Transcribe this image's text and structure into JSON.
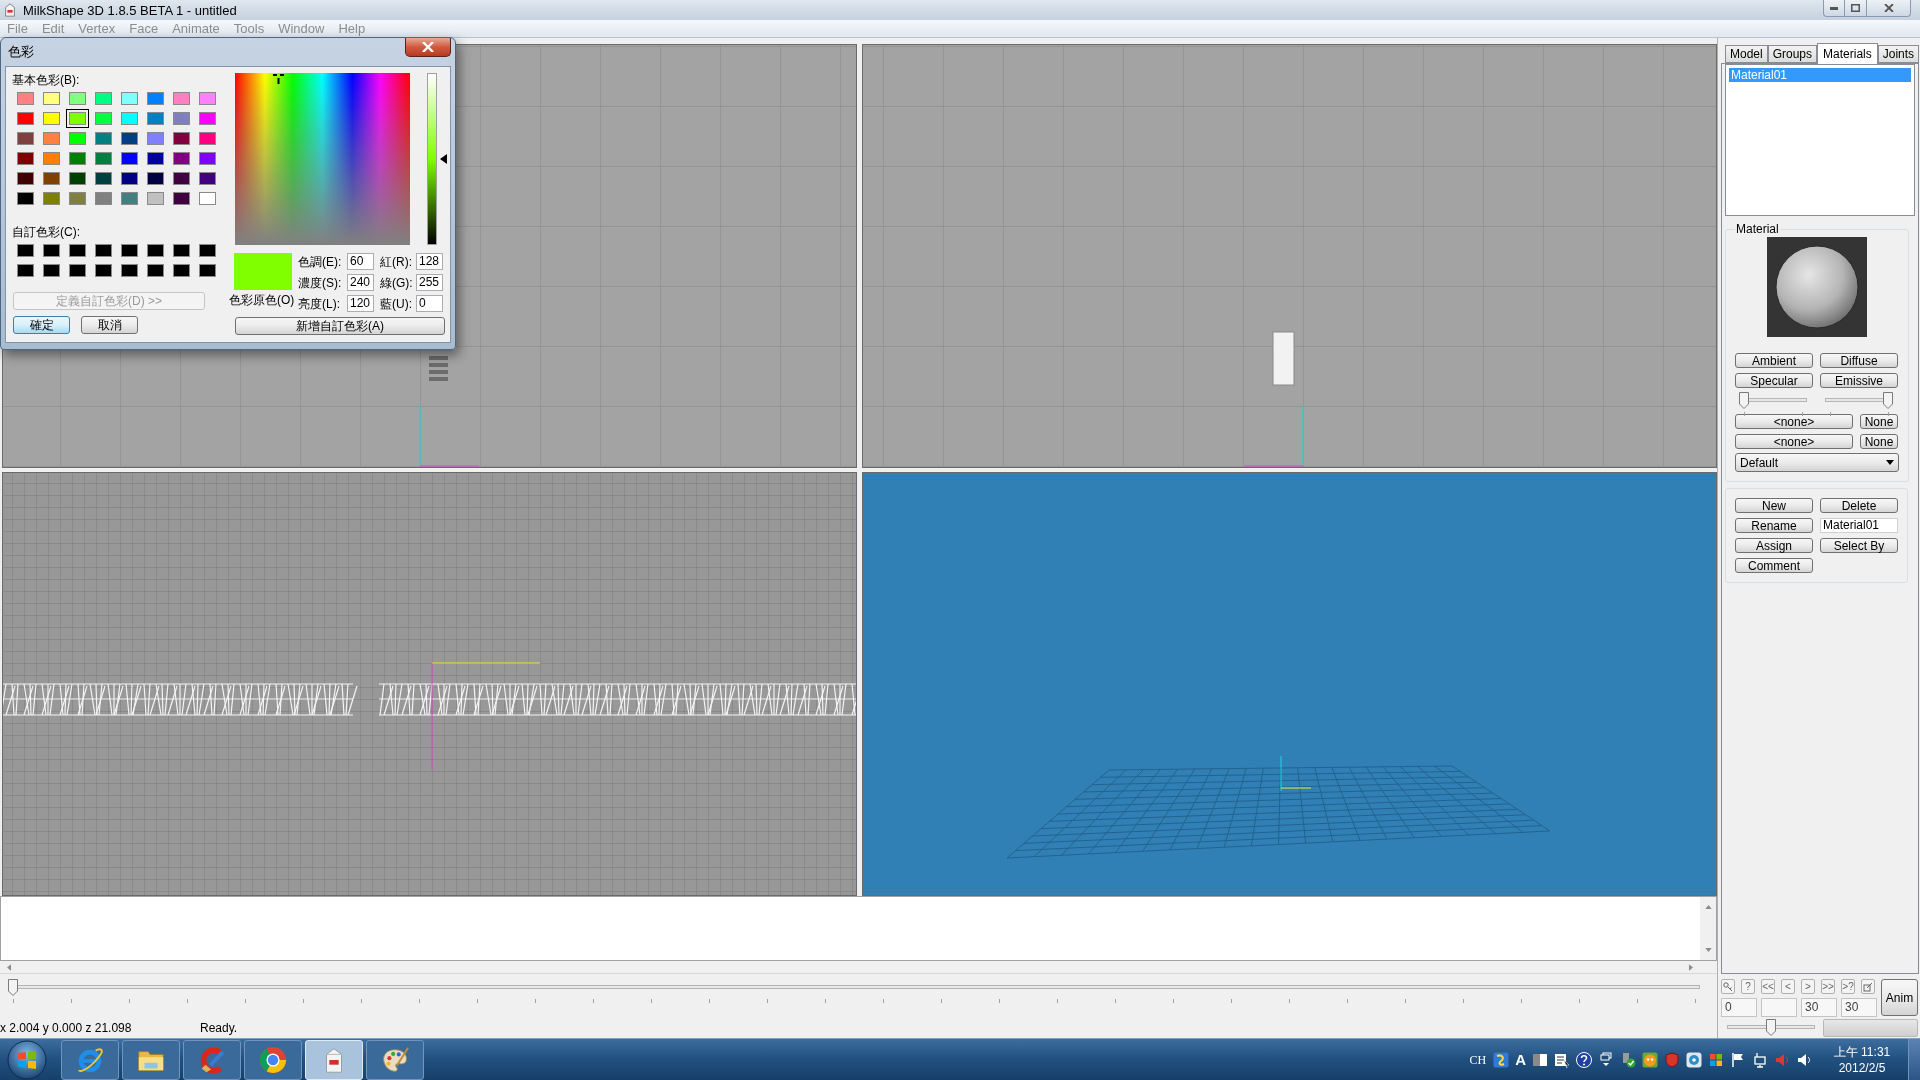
{
  "window": {
    "title": "MilkShape 3D 1.8.5 BETA 1 - untitled"
  },
  "menu": [
    {
      "label": "File",
      "disabled": true
    },
    {
      "label": "Edit",
      "disabled": true
    },
    {
      "label": "Vertex",
      "disabled": true
    },
    {
      "label": "Face",
      "disabled": true
    },
    {
      "label": "Animate",
      "disabled": true
    },
    {
      "label": "Tools",
      "disabled": true
    },
    {
      "label": "Window",
      "disabled": true
    },
    {
      "label": "Help",
      "disabled": true
    }
  ],
  "color_dialog": {
    "title": "色彩",
    "basic_label": "基本色彩(B):",
    "basic_colors": [
      {
        "color": "#ff8080",
        "selected": false
      },
      {
        "color": "#ffff80",
        "selected": false
      },
      {
        "color": "#80ff80",
        "selected": false
      },
      {
        "color": "#00ff80",
        "selected": false
      },
      {
        "color": "#80ffff",
        "selected": false
      },
      {
        "color": "#0080ff",
        "selected": false
      },
      {
        "color": "#ff80c0",
        "selected": false
      },
      {
        "color": "#ff80ff",
        "selected": false
      },
      {
        "color": "#ff0000",
        "selected": false
      },
      {
        "color": "#ffff00",
        "selected": false
      },
      {
        "color": "#80ff00",
        "selected": true
      },
      {
        "color": "#00ff40",
        "selected": false
      },
      {
        "color": "#00ffff",
        "selected": false
      },
      {
        "color": "#0080c0",
        "selected": false
      },
      {
        "color": "#8080c0",
        "selected": false
      },
      {
        "color": "#ff00ff",
        "selected": false
      },
      {
        "color": "#804040",
        "selected": false
      },
      {
        "color": "#ff8040",
        "selected": false
      },
      {
        "color": "#00ff00",
        "selected": false
      },
      {
        "color": "#008080",
        "selected": false
      },
      {
        "color": "#004080",
        "selected": false
      },
      {
        "color": "#8080ff",
        "selected": false
      },
      {
        "color": "#800040",
        "selected": false
      },
      {
        "color": "#ff0080",
        "selected": false
      },
      {
        "color": "#800000",
        "selected": false
      },
      {
        "color": "#ff8000",
        "selected": false
      },
      {
        "color": "#008000",
        "selected": false
      },
      {
        "color": "#008040",
        "selected": false
      },
      {
        "color": "#0000ff",
        "selected": false
      },
      {
        "color": "#0000a0",
        "selected": false
      },
      {
        "color": "#800080",
        "selected": false
      },
      {
        "color": "#8000ff",
        "selected": false
      },
      {
        "color": "#400000",
        "selected": false
      },
      {
        "color": "#804000",
        "selected": false
      },
      {
        "color": "#004000",
        "selected": false
      },
      {
        "color": "#004040",
        "selected": false
      },
      {
        "color": "#000080",
        "selected": false
      },
      {
        "color": "#000040",
        "selected": false
      },
      {
        "color": "#400040",
        "selected": false
      },
      {
        "color": "#400080",
        "selected": false
      },
      {
        "color": "#000000",
        "selected": false
      },
      {
        "color": "#808000",
        "selected": false
      },
      {
        "color": "#808040",
        "selected": false
      },
      {
        "color": "#808080",
        "selected": false
      },
      {
        "color": "#408080",
        "selected": false
      },
      {
        "color": "#c0c0c0",
        "selected": false
      },
      {
        "color": "#400040",
        "selected": false
      },
      {
        "color": "#ffffff",
        "selected": false
      }
    ],
    "custom_label": "自訂色彩(C):",
    "custom_colors": [
      {
        "color": "#000000",
        "selected": false
      },
      {
        "color": "#000000",
        "selected": false
      },
      {
        "color": "#000000",
        "selected": false
      },
      {
        "color": "#000000",
        "selected": false
      },
      {
        "color": "#000000",
        "selected": false
      },
      {
        "color": "#000000",
        "selected": false
      },
      {
        "color": "#000000",
        "selected": false
      },
      {
        "color": "#000000",
        "selected": false
      },
      {
        "color": "#000000",
        "selected": false
      },
      {
        "color": "#000000",
        "selected": false
      },
      {
        "color": "#000000",
        "selected": false
      },
      {
        "color": "#000000",
        "selected": false
      },
      {
        "color": "#000000",
        "selected": false
      },
      {
        "color": "#000000",
        "selected": false
      },
      {
        "color": "#000000",
        "selected": false
      },
      {
        "color": "#000000",
        "selected": false
      }
    ],
    "define_button": {
      "label": "定義自訂色彩(D) >>",
      "disabled": true
    },
    "ok_button": "確定",
    "cancel_button": "取消",
    "luminance": {
      "level": 0.5
    },
    "preview": {
      "color": "#80ff00",
      "label": "色彩原色(O)"
    },
    "fields": [
      {
        "label": "色調(E):",
        "value": "60"
      },
      {
        "label": "紅(R):",
        "value": "128"
      },
      {
        "label": "濃度(S):",
        "value": "240"
      },
      {
        "label": "綠(G):",
        "value": "255"
      },
      {
        "label": "亮度(L):",
        "value": "120"
      },
      {
        "label": "藍(U):",
        "value": "0"
      }
    ],
    "add_button": "新增自訂色彩(A)"
  },
  "side_panel": {
    "tabs": [
      {
        "label": "Model",
        "selected": false
      },
      {
        "label": "Groups",
        "selected": false
      },
      {
        "label": "Materials",
        "selected": true
      },
      {
        "label": "Joints",
        "selected": false
      }
    ],
    "material_list": [
      {
        "name": "Material01",
        "selected": true
      }
    ],
    "material_group": {
      "title": "Material",
      "color_buttons": [
        "Ambient",
        "Diffuse",
        "Specular",
        "Emissive"
      ],
      "sliders": [
        {
          "level": 0
        },
        {
          "level": 1
        }
      ],
      "texture_rows": [
        {
          "texture": "<none>",
          "clear": "None"
        },
        {
          "texture": "<none>",
          "clear": "None"
        }
      ],
      "mode_select": {
        "value": "Default"
      }
    },
    "actions": [
      {
        "kind": "button",
        "label": "New"
      },
      {
        "kind": "button",
        "label": "Delete"
      },
      {
        "kind": "button",
        "label": "Rename"
      },
      {
        "kind": "field",
        "value": "Material01"
      },
      {
        "kind": "button",
        "label": "Assign"
      },
      {
        "kind": "button",
        "label": "Select By"
      },
      {
        "kind": "button",
        "label": "Comment"
      }
    ]
  },
  "timeline": {
    "level": 0
  },
  "anim_controls": {
    "buttons": [
      {
        "kind": "key"
      },
      {
        "kind": "text",
        "label": "?"
      },
      {
        "kind": "text",
        "label": "<<"
      },
      {
        "kind": "text",
        "label": "<"
      },
      {
        "kind": "text",
        "label": ">"
      },
      {
        "kind": "text",
        "label": ">>"
      },
      {
        "kind": "text",
        "label": ">?"
      },
      {
        "kind": "frame"
      }
    ],
    "frame_fields": [
      {
        "kind": "filled",
        "value": "0"
      },
      {
        "kind": "blank"
      },
      {
        "kind": "filled",
        "value": "30"
      },
      {
        "kind": "filled",
        "value": "30"
      }
    ],
    "anim_button": "Anim",
    "frame_slider": {
      "level": 0.5
    }
  },
  "status_bar": {
    "coords": "x 2.004 y 0.000 z 21.098",
    "message": "Ready."
  },
  "taskbar": {
    "apps": [
      {
        "kind": "globe",
        "active": false
      },
      {
        "kind": "folder",
        "active": false
      },
      {
        "kind": "brush",
        "active": false
      },
      {
        "kind": "wheel",
        "active": false
      },
      {
        "kind": "carton",
        "active": true
      },
      {
        "kind": "palette",
        "active": false
      }
    ],
    "tray": {
      "language": "CH",
      "ime_mode": "A",
      "time": "上午 11:31",
      "date": "2012/2/5"
    }
  }
}
